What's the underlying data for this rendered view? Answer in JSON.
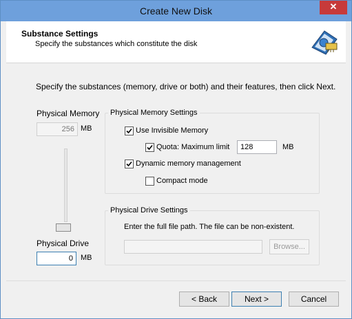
{
  "window": {
    "title": "Create New Disk",
    "close_label": "✕"
  },
  "header": {
    "title": "Substance Settings",
    "subtitle": "Specify the substances which constitute the disk",
    "icon": "disk-icon"
  },
  "intro": "Specify the substances (memory, drive or both) and their features, then click Next.",
  "physical_memory": {
    "label": "Physical Memory",
    "value": "256",
    "unit": "MB",
    "slider_level": 0.0
  },
  "memory_settings": {
    "title": "Physical Memory Settings",
    "use_invisible": {
      "label": "Use Invisible Memory",
      "checked": true
    },
    "quota": {
      "label": "Quota: Maximum limit",
      "checked": true,
      "value": "128",
      "unit": "MB"
    },
    "dynamic": {
      "label": "Dynamic memory management",
      "checked": true
    },
    "compact": {
      "label": "Compact mode",
      "checked": false
    }
  },
  "physical_drive": {
    "label": "Physical Drive",
    "value": "0",
    "unit": "MB"
  },
  "drive_settings": {
    "title": "Physical Drive Settings",
    "hint": "Enter the full file path. The file can be non-existent.",
    "path_value": "",
    "browse_label": "Browse..."
  },
  "buttons": {
    "back": "< Back",
    "next": "Next >",
    "cancel": "Cancel"
  }
}
